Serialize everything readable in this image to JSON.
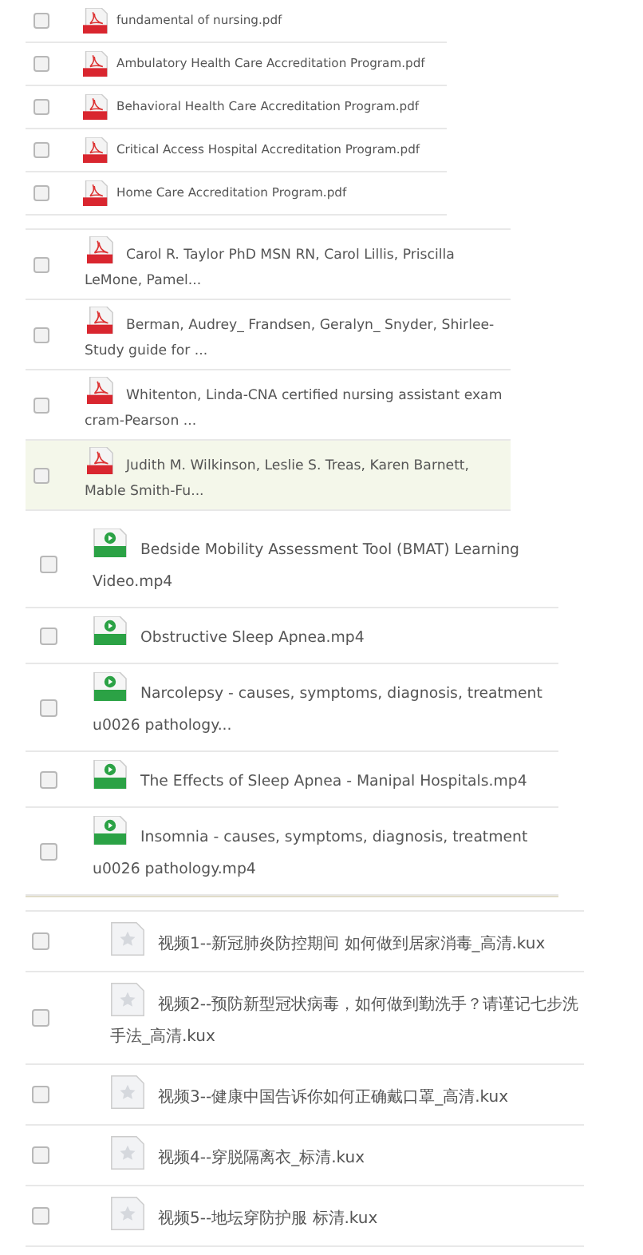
{
  "groups": [
    {
      "kind": "pdf-small",
      "rows": [
        {
          "name": "fundamental of nursing.pdf",
          "checked": false,
          "selected": false
        },
        {
          "name": "Ambulatory Health Care Accreditation Program.pdf",
          "checked": false,
          "selected": false
        },
        {
          "name": "Behavioral Health Care Accreditation Program.pdf",
          "checked": false,
          "selected": false
        },
        {
          "name": "Critical Access Hospital Accreditation Program.pdf",
          "checked": false,
          "selected": false
        },
        {
          "name": "Home Care Accreditation Program.pdf",
          "checked": false,
          "selected": false
        }
      ]
    },
    {
      "kind": "pdf",
      "rows": [
        {
          "name": "Carol R. Taylor PhD MSN RN, Carol Lillis, Priscilla LeMone, Pamel...",
          "checked": false,
          "selected": false
        },
        {
          "name": "Berman, Audrey_ Frandsen, Geralyn_ Snyder, Shirlee-Study guide for ...",
          "checked": false,
          "selected": false
        },
        {
          "name": "Whitenton, Linda-CNA certified nursing assistant exam cram-Pearson ...",
          "checked": false,
          "selected": false
        },
        {
          "name": "Judith M. Wilkinson, Leslie S. Treas, Karen Barnett, Mable Smith-Fu...",
          "checked": false,
          "selected": true
        }
      ]
    },
    {
      "kind": "video",
      "rows": [
        {
          "name": "Bedside Mobility Assessment Tool (BMAT) Learning Video.mp4",
          "checked": false,
          "selected": false
        },
        {
          "name": "Obstructive Sleep Apnea.mp4",
          "checked": false,
          "selected": false
        },
        {
          "name": "Narcolepsy - causes, symptoms, diagnosis, treatment u0026 pathology...",
          "checked": false,
          "selected": false
        },
        {
          "name": "The Effects of Sleep Apnea - Manipal Hospitals.mp4",
          "checked": false,
          "selected": false
        },
        {
          "name": "Insomnia - causes, symptoms, diagnosis, treatment u0026 pathology.mp4",
          "checked": false,
          "selected": false
        }
      ]
    },
    {
      "kind": "kux",
      "rows": [
        {
          "name": "视频1--新冠肺炎防控期间 如何做到居家消毒_高清.kux",
          "checked": false,
          "selected": false
        },
        {
          "name": "视频2--预防新型冠状病毒，如何做到勤洗手？请谨记七步洗手法_高清.kux",
          "checked": false,
          "selected": false
        },
        {
          "name": "视频3--健康中国告诉你如何正确戴口罩_高清.kux",
          "checked": false,
          "selected": false
        },
        {
          "name": "视频4--穿脱隔离衣_标清.kux",
          "checked": false,
          "selected": false
        },
        {
          "name": "视频5--地坛穿防护服 标清.kux",
          "checked": false,
          "selected": false
        }
      ]
    }
  ]
}
